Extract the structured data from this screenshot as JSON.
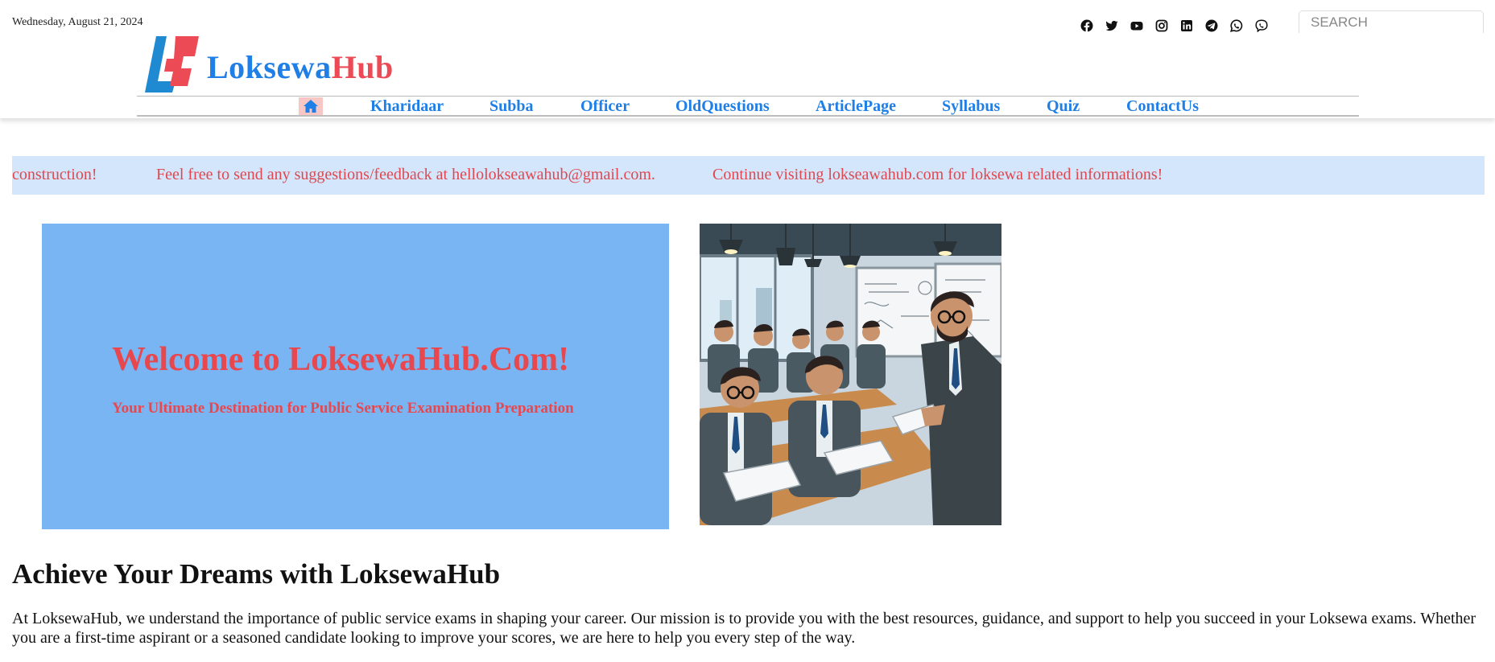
{
  "header": {
    "date": "Wednesday, August 21, 2024",
    "search_placeholder": "SEARCH",
    "social_icons": [
      "facebook-icon",
      "twitter-icon",
      "youtube-icon",
      "instagram-icon",
      "linkedin-icon",
      "telegram-icon",
      "whatsapp-icon",
      "viber-icon"
    ]
  },
  "logo": {
    "part1": "Loksewa",
    "part2": "Hub",
    "colors": {
      "part1": "#1f7fe6",
      "part2": "#ec4a55"
    }
  },
  "nav": {
    "home_icon": "home-icon",
    "items": [
      "Kharidaar",
      "Subba",
      "Officer",
      "OldQuestions",
      "ArticlePage",
      "Syllabus",
      "Quiz",
      "ContactUs"
    ]
  },
  "ticker": {
    "messages": [
      "construction!",
      "Feel free to send any suggestions/feedback at hellolokseawahub@gmail.com.",
      "Continue visiting lokseawahub.com for loksewa related informations!"
    ]
  },
  "hero": {
    "title": "Welcome to LoksewaHub.Com!",
    "subtitle": "Your Ultimate Destination for Public Service Examination Preparation",
    "background_color": "#7ab5f3",
    "text_color": "#e8474e"
  },
  "about": {
    "title": "Achieve Your Dreams with LoksewaHub",
    "text": "At LoksewaHub, we understand the importance of public service exams in shaping your career. Our mission is to provide you with the best resources, guidance, and support to help you succeed in your Loksewa exams. Whether you are a first-time aspirant or a seasoned candidate looking to improve your scores, we are here to help you every step of the way."
  }
}
